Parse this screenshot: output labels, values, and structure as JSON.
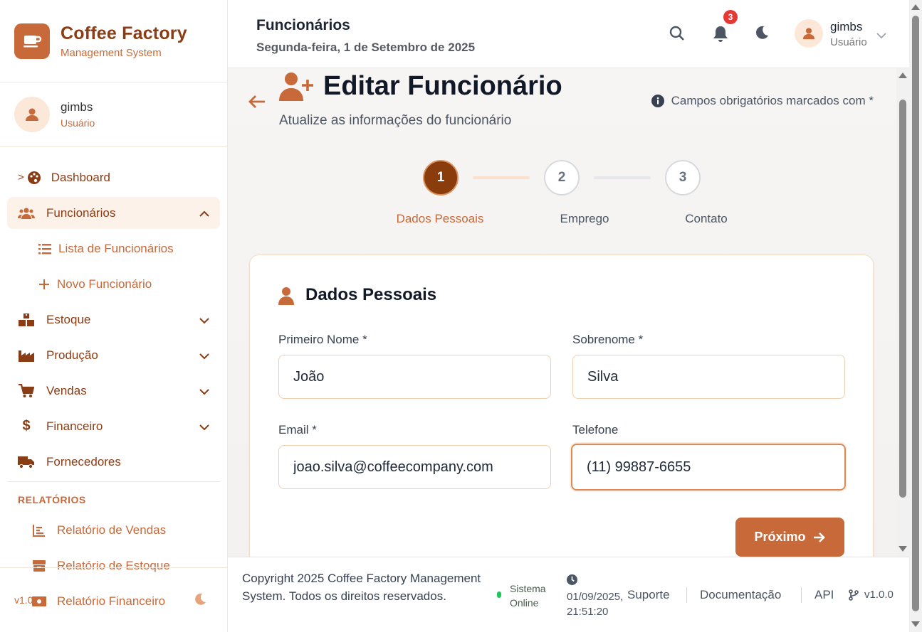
{
  "brand": {
    "title": "Coffee Factory",
    "subtitle": "Management System"
  },
  "sidebar_user": {
    "name": "gimbs",
    "role": "Usuário"
  },
  "nav": {
    "dashboard": "Dashboard",
    "funcionarios": "Funcionários",
    "lista": "Lista de Funcionários",
    "novo": "Novo Funcionário",
    "estoque": "Estoque",
    "producao": "Produção",
    "vendas": "Vendas",
    "financeiro": "Financeiro",
    "fornecedores": "Fornecedores",
    "dashboard_marker": ">"
  },
  "reports": {
    "label": "RELATÓRIOS",
    "vendas": "Relatório de Vendas",
    "estoque": "Relatório de Estoque",
    "financeiro": "Relatório Financeiro"
  },
  "sidebar_version": "v1.0.0",
  "header": {
    "title": "Funcionários",
    "date": "Segunda-feira, 1 de Setembro de 2025",
    "notifications": "3",
    "user_name": "gimbs",
    "user_role": "Usuário"
  },
  "page": {
    "title": "Editar Funcionário",
    "subtitle": "Atualize as informações do funcionário",
    "required_note": "Campos obrigatórios marcados com *"
  },
  "steps": [
    {
      "num": "1",
      "label": "Dados Pessoais",
      "state": "active"
    },
    {
      "num": "2",
      "label": "Emprego",
      "state": "idle"
    },
    {
      "num": "3",
      "label": "Contato",
      "state": "idle"
    }
  ],
  "form": {
    "section_title": "Dados Pessoais",
    "first_name_label": "Primeiro Nome *",
    "first_name": "João",
    "last_name_label": "Sobrenome *",
    "last_name": "Silva",
    "email_label": "Email *",
    "email": "joao.silva@coffeecompany.com",
    "phone_label": "Telefone",
    "phone": "(11) 99887-6655",
    "next_label": "Próximo"
  },
  "footer": {
    "copyright": "Copyright 2025 Coffee Factory Management System. Todos os direitos reservados.",
    "status": "Sistema Online",
    "datetime": "01/09/2025,",
    "time": "21:51:20",
    "support": "Suporte",
    "docs": "Documentação",
    "api": "API",
    "version": "v1.0.0"
  },
  "colors": {
    "accent": "#c8693a",
    "brand_dark": "#8a3c14",
    "step_active": "#8a3c0c",
    "status_online": "#22c55e",
    "badge": "#e53935"
  },
  "icons": {
    "brand": "coffee-cup-icon",
    "dashboard": "palette-icon",
    "funcionarios": "users-icon",
    "estoque": "boxes-icon",
    "producao": "industry-icon",
    "vendas": "cart-icon",
    "financeiro": "dollar-icon",
    "fornecedores": "truck-icon",
    "search": "search-icon",
    "notifications": "bell-icon",
    "theme": "moon-icon"
  }
}
